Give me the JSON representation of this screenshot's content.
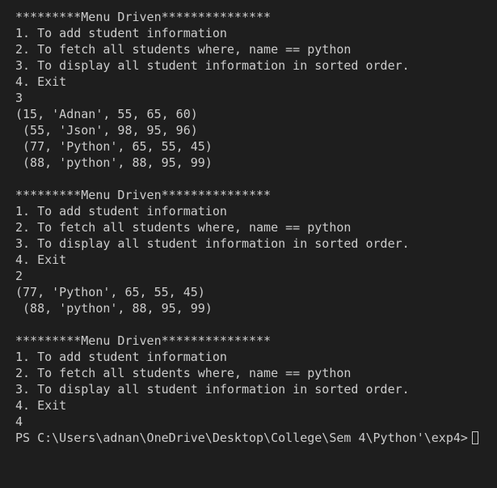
{
  "terminal": {
    "lines": [
      "*********Menu Driven***************",
      "1. To add student information",
      "2. To fetch all students where, name == python",
      "3. To display all student information in sorted order.",
      "4. Exit",
      "3",
      "(15, 'Adnan', 55, 65, 60)",
      " (55, 'Json', 98, 95, 96)",
      " (77, 'Python', 65, 55, 45)",
      " (88, 'python', 88, 95, 99)",
      "",
      "*********Menu Driven***************",
      "1. To add student information",
      "2. To fetch all students where, name == python",
      "3. To display all student information in sorted order.",
      "4. Exit",
      "2",
      "(77, 'Python', 65, 55, 45)",
      " (88, 'python', 88, 95, 99)",
      "",
      "*********Menu Driven***************",
      "1. To add student information",
      "2. To fetch all students where, name == python",
      "3. To display all student information in sorted order.",
      "4. Exit",
      "4"
    ],
    "prompt": "PS C:\\Users\\adnan\\OneDrive\\Desktop\\College\\Sem 4\\Python'\\exp4>"
  },
  "colors": {
    "background": "#1e1e1e",
    "text": "#cccccc"
  }
}
